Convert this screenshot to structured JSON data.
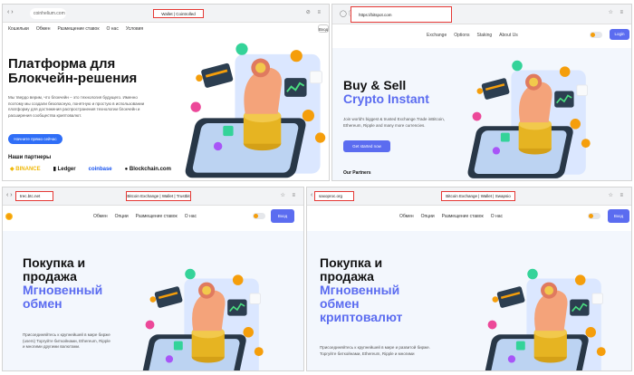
{
  "panel1": {
    "url": "coinhelium.com",
    "tab_title": "Wallet | Cointrolled",
    "nav": [
      "Кошельки",
      "Обмен",
      "Размещение ставок",
      "О нас",
      "Условия"
    ],
    "login_label": "Вход",
    "hero_line1": "Платформа для",
    "hero_line2": "Блокчейн-решения",
    "description": "Мы твердо верим, что блокчейн – это технология будущего. Именно поэтому мы создали безопасную, понятную и простую в использовании платформу для достижения распространения технологии блокчейн и расширения сообщества криптовалют.",
    "cta_label": "Начните прямо сейчас",
    "partners_title": "Наши партнеры",
    "partners": [
      "◆ BINANCE",
      "▮ Ledger",
      "coinbase",
      "● Blockchain.com"
    ]
  },
  "panel2": {
    "url": "https://bitspot.com",
    "nav": [
      "Exchange",
      "Options",
      "Staking",
      "About Us"
    ],
    "login_label": "Login",
    "hero_line1": "Buy & Sell",
    "hero_line2": "Crypto Instant",
    "description": "Join world's biggest & trusted Exchange.Trade inBitcoin, Ethereum, Ripple and many more currencies.",
    "cta_label": "Get started now",
    "partners_title": "Our Partners"
  },
  "panel3": {
    "url": "trec.btc.net",
    "tab_title": "Bitcoin Exchange | Wallet | Trustbit",
    "nav": [
      "Обмен",
      "Опции",
      "Размещение ставок",
      "О нас"
    ],
    "login_label": "Вход",
    "hero_line1": "Покупка и",
    "hero_line2": "продажа",
    "hero_accent1": "Мгновенный",
    "hero_accent2": "обмен",
    "description": "Присоединяйтесь к крупнейшей в мире бирже (users) Торгуйте биткойнами, Ethereum, Ripple и многими другими валютами."
  },
  "panel4": {
    "url": "saxoproc.org",
    "tab_title": "Bitcoin Exchange | Wallet | Swapsio",
    "nav": [
      "Обмен",
      "Опции",
      "Размещение ставок",
      "О нас"
    ],
    "login_label": "Вход",
    "hero_line1": "Покупка и",
    "hero_line2": "продажа",
    "hero_accent1": "Мгновенный",
    "hero_accent2": "обмен",
    "hero_accent3": "криптовалют",
    "description": "Присоединяйтесь к крупнейшей в мире и развитой бирже. Торгуйте биткойнами, Ethereum, Ripple и многими"
  },
  "colors": {
    "accent": "#5b6cf0",
    "highlight": "#e53935",
    "coin": "#f59e0b",
    "cta_blue": "#2f6ef7"
  },
  "icons": [
    "back-icon",
    "reload-icon",
    "lock-icon",
    "star-icon",
    "menu-icon",
    "coin-logo-icon",
    "hand-with-coins-illustration"
  ]
}
